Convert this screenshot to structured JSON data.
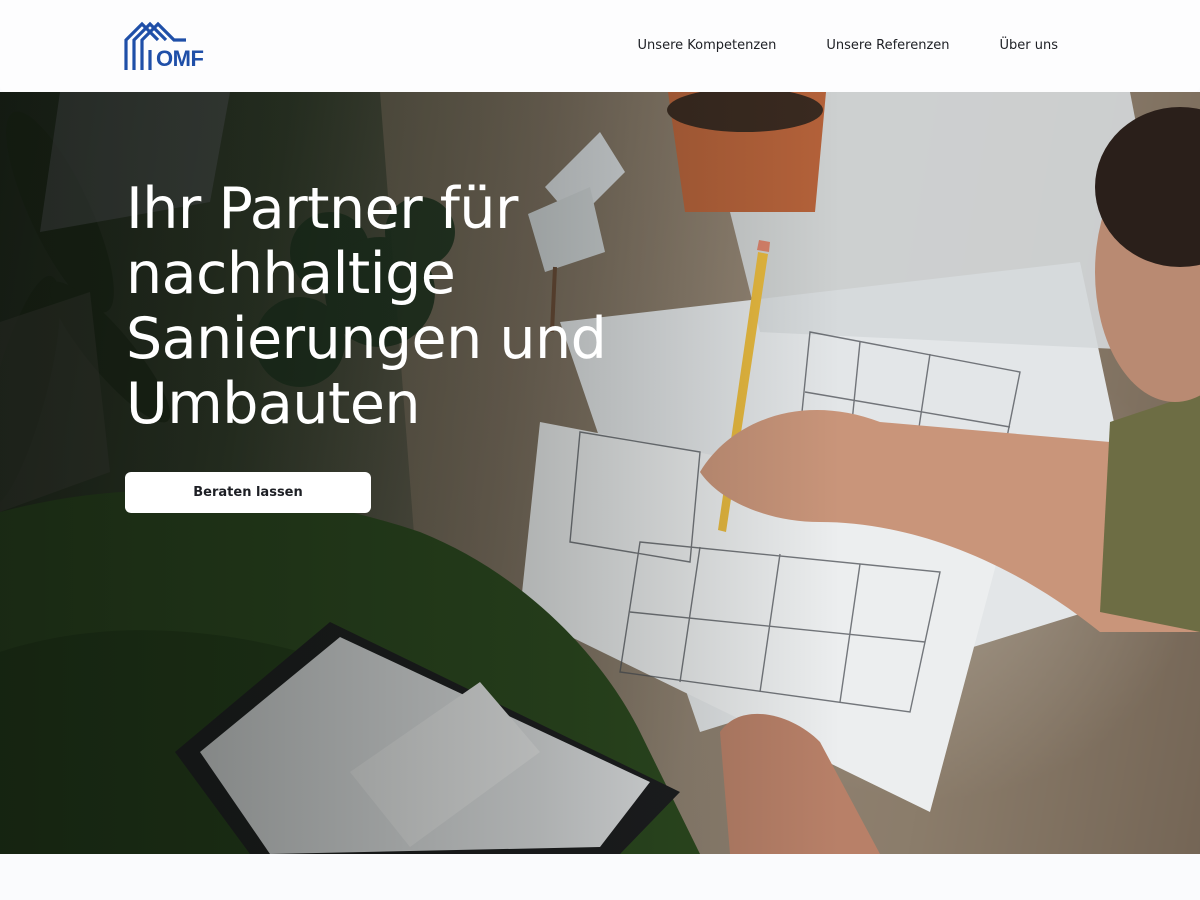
{
  "brand": {
    "name": "OMF",
    "color": "#1f4fa8"
  },
  "nav": {
    "items": [
      {
        "label": "Unsere Kompetenzen"
      },
      {
        "label": "Unsere Referenzen"
      },
      {
        "label": "Über uns"
      }
    ]
  },
  "hero": {
    "title": "Ihr Partner für nachhaltige Sanierungen und Umbauten",
    "cta_label": "Beraten lassen",
    "image_subject": "architect-drawing-floor-plans-photo"
  }
}
